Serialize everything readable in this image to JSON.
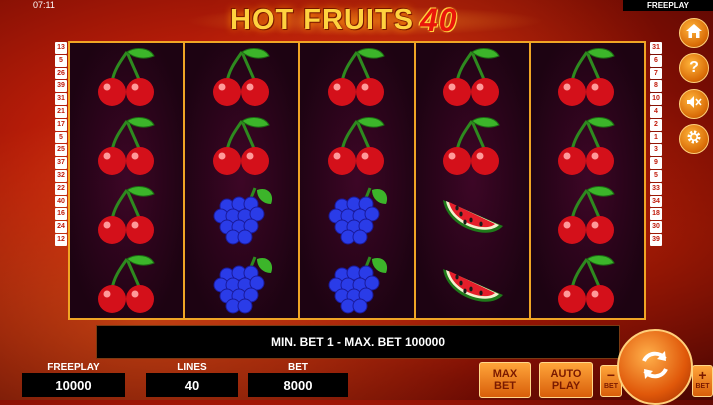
{
  "status": {
    "clock": "07:11",
    "mode": "FREEPLAY"
  },
  "title": {
    "part1": "HOT FRUITS",
    "part2": "40"
  },
  "reels": [
    [
      "cherry",
      "cherry",
      "cherry",
      "cherry"
    ],
    [
      "cherry",
      "cherry",
      "grapes",
      "grapes"
    ],
    [
      "cherry",
      "cherry",
      "grapes",
      "grapes"
    ],
    [
      "cherry",
      "cherry",
      "watermelon",
      "watermelon"
    ],
    [
      "cherry",
      "cherry",
      "cherry",
      "cherry"
    ]
  ],
  "paylines_left": [
    "13",
    "5",
    "26",
    "39",
    "31",
    "21",
    "17",
    "5",
    "25",
    "37",
    "32",
    "22",
    "40",
    "16",
    "24",
    "12"
  ],
  "paylines_right": [
    "31",
    "6",
    "7",
    "8",
    "10",
    "4",
    "2",
    "1",
    "3",
    "9",
    "5",
    "33",
    "34",
    "18",
    "30",
    "39"
  ],
  "side_buttons": [
    {
      "icon": "home-icon"
    },
    {
      "icon": "help-icon"
    },
    {
      "icon": "sound-mute-icon"
    },
    {
      "icon": "settings-gear-icon"
    }
  ],
  "info_bar": "MIN. BET 1 - MAX. BET 100000",
  "bottom": {
    "freeplay_label": "FREEPLAY",
    "freeplay_value": "10000",
    "lines_label": "LINES",
    "lines_value": "40",
    "bet_label": "BET",
    "bet_value": "8000"
  },
  "buttons": {
    "max_bet_line1": "MAX",
    "max_bet_line2": "BET",
    "auto_play_line1": "AUTO",
    "auto_play_line2": "PLAY",
    "minus": "−",
    "plus": "+",
    "bet_small": "BET"
  }
}
